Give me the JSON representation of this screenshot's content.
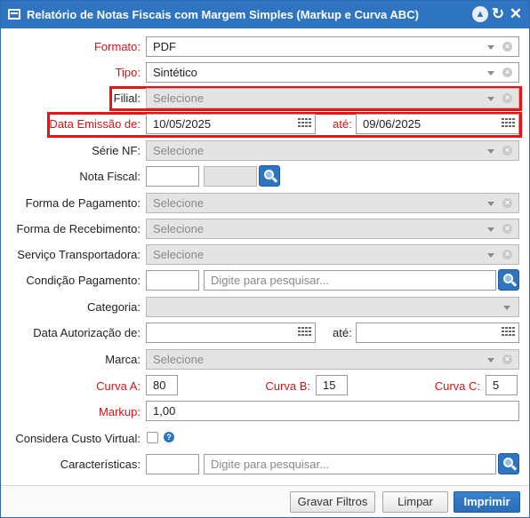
{
  "window": {
    "title": "Relatório de Notas Fiscais com Margem Simples (Markup e Curva ABC)",
    "icons": [
      "collapse-up-icon",
      "refresh-icon",
      "close-icon"
    ]
  },
  "form": {
    "formato": {
      "label": "Formato:",
      "value": "PDF"
    },
    "tipo": {
      "label": "Tipo:",
      "value": "Sintético"
    },
    "filial": {
      "label": "Filial:",
      "placeholder": "Selecione"
    },
    "data_emissao": {
      "label": "Data Emissão de:",
      "from": "10/05/2025",
      "to_label": "até:",
      "to": "09/06/2025"
    },
    "serie_nf": {
      "label": "Série NF:",
      "placeholder": "Selecione"
    },
    "nota_fiscal": {
      "label": "Nota Fiscal:",
      "value": "",
      "value2": ""
    },
    "forma_pagamento": {
      "label": "Forma de Pagamento:",
      "placeholder": "Selecione"
    },
    "forma_recebimento": {
      "label": "Forma de Recebimento:",
      "placeholder": "Selecione"
    },
    "servico_transportadora": {
      "label": "Serviço Transportadora:",
      "placeholder": "Selecione"
    },
    "condicao_pagamento": {
      "label": "Condição Pagamento:",
      "code": "",
      "placeholder": "Digite para pesquisar..."
    },
    "categoria": {
      "label": "Categoria:",
      "value": ""
    },
    "data_autorizacao": {
      "label": "Data Autorização de:",
      "from": "",
      "to_label": "até:",
      "to": ""
    },
    "marca": {
      "label": "Marca:",
      "placeholder": "Selecione"
    },
    "curva_a": {
      "label": "Curva A:",
      "value": "80"
    },
    "curva_b": {
      "label": "Curva B:",
      "value": "15"
    },
    "curva_c": {
      "label": "Curva C:",
      "value": "5"
    },
    "markup": {
      "label": "Markup:",
      "value": "1,00"
    },
    "custo_virtual": {
      "label": "Considera Custo Virtual:",
      "checked": false
    },
    "caracteristicas": {
      "label": "Características:",
      "code": "",
      "placeholder": "Digite para pesquisar..."
    }
  },
  "footer": {
    "gravar_filtros": "Gravar Filtros",
    "limpar": "Limpar",
    "imprimir": "Imprimir"
  },
  "colors": {
    "title_bar": "#2e74c0",
    "required_label": "#d4141b",
    "highlight": "#e11111"
  }
}
